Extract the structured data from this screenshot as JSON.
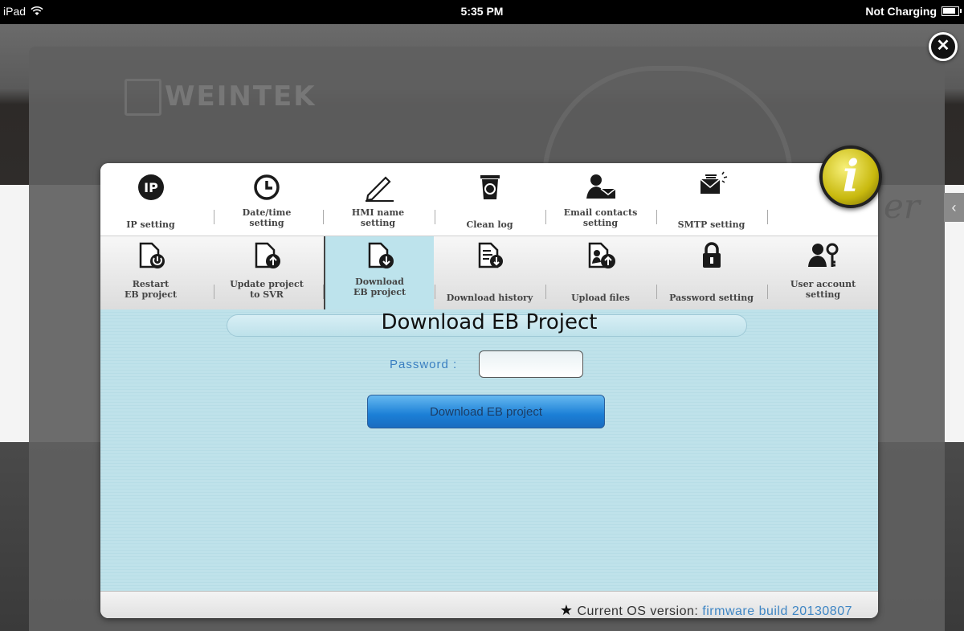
{
  "status_bar": {
    "device": "iPad",
    "time": "5:35 PM",
    "battery_status": "Not Charging"
  },
  "background": {
    "brand": "WEINTEK",
    "cloud_text": "er"
  },
  "tabs_row1": [
    {
      "label": "IP setting",
      "icon": "ip-icon"
    },
    {
      "label": "Date/time\nsetting",
      "icon": "clock-icon"
    },
    {
      "label": "HMI name\nsetting",
      "icon": "pencil-icon"
    },
    {
      "label": "Clean log",
      "icon": "trash-icon"
    },
    {
      "label": "Email contacts\nsetting",
      "icon": "contact-mail-icon"
    },
    {
      "label": "SMTP setting",
      "icon": "mail-send-icon"
    }
  ],
  "tabs_row2": [
    {
      "label": "Restart\nEB project",
      "icon": "restart-project-icon"
    },
    {
      "label": "Update project\nto SVR",
      "icon": "upload-project-icon"
    },
    {
      "label": "Download\nEB project",
      "icon": "download-project-icon",
      "active": true
    },
    {
      "label": "Download history",
      "icon": "download-history-icon"
    },
    {
      "label": "Upload files",
      "icon": "upload-files-icon"
    },
    {
      "label": "Password setting",
      "icon": "lock-icon"
    },
    {
      "label": "User account\nsetting",
      "icon": "user-key-icon"
    }
  ],
  "content": {
    "title": "Download EB Project",
    "password_label": "Password :",
    "password_value": "",
    "download_button": "Download EB project"
  },
  "footer": {
    "prefix": "Current OS version: ",
    "firmware": "firmware build 20130807"
  },
  "colors": {
    "content_bg": "#bfe2ea",
    "button_blue": "#1b7fd6",
    "label_blue": "#3a7fc1",
    "info_yellow": "#d4c51a"
  }
}
